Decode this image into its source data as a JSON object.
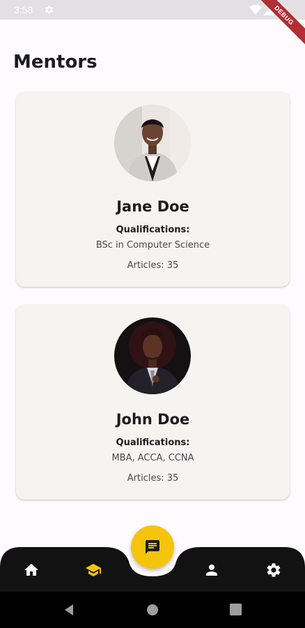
{
  "status_bar": {
    "time": "3:58",
    "debug_label": "DEBUG"
  },
  "page": {
    "title": "Mentors"
  },
  "mentors": [
    {
      "name": "Jane Doe",
      "qualifications_label": "Qualifications:",
      "qualifications": "BSc in Computer Science",
      "articles": "Articles: 35"
    },
    {
      "name": "John Doe",
      "qualifications_label": "Qualifications:",
      "qualifications": "MBA, ACCA, CCNA",
      "articles": "Articles: 35"
    }
  ],
  "bottom_nav": {
    "items": [
      "home-icon",
      "school-icon",
      "chat-icon",
      "person-icon",
      "settings-icon"
    ],
    "active_item": "school-icon",
    "colors": {
      "bar": "#121212",
      "active": "#f5c40d",
      "inactive": "#ffffff",
      "fab": "#f5c40d"
    }
  }
}
